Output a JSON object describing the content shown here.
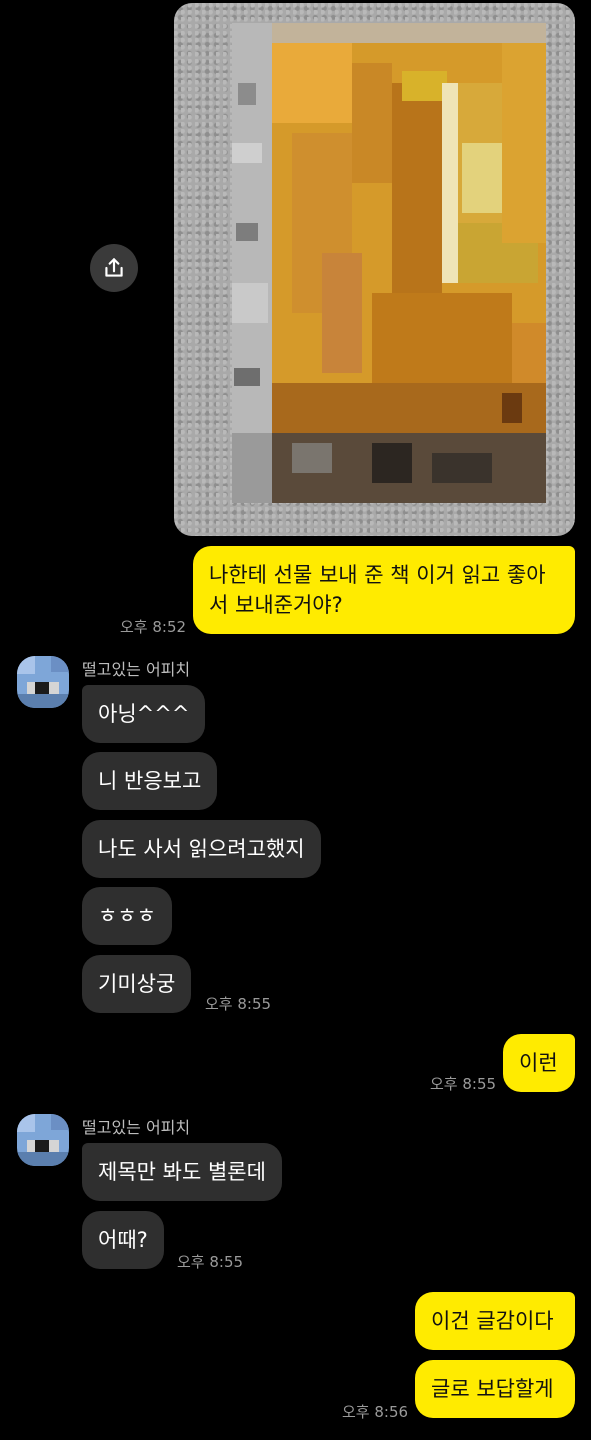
{
  "photo": {
    "description_icon": "image-thumbnail"
  },
  "share_icon": "share-upload-icon",
  "messages": [
    {
      "id": "m1",
      "side": "out",
      "text": "나한테 선물 보내 준 책 이거 읽고 좋아서 보내준거야?",
      "time": "오후 8:52"
    },
    {
      "id": "g1",
      "sender": "떨고있는 어피치"
    },
    {
      "id": "m2",
      "side": "in",
      "text": "아닝^^^"
    },
    {
      "id": "m3",
      "side": "in",
      "text": "니 반응보고"
    },
    {
      "id": "m4",
      "side": "in",
      "text": "나도 사서 읽으려고했지"
    },
    {
      "id": "m5",
      "side": "in",
      "text": "ㅎㅎㅎ"
    },
    {
      "id": "m6",
      "side": "in",
      "text": "기미상궁",
      "time": "오후 8:55"
    },
    {
      "id": "m7",
      "side": "out",
      "text": "이런",
      "time": "오후 8:55"
    },
    {
      "id": "g2",
      "sender": "떨고있는 어피치"
    },
    {
      "id": "m8",
      "side": "in",
      "text": "제목만 봐도 별론데"
    },
    {
      "id": "m9",
      "side": "in",
      "text": "어때?",
      "time": "오후 8:55"
    },
    {
      "id": "m10",
      "side": "out",
      "text": "이건 글감이다"
    },
    {
      "id": "m11",
      "side": "out",
      "text": "글로 보답할게",
      "time": "오후 8:56"
    }
  ],
  "colors": {
    "background": "#000000",
    "incoming_bubble": "#2f2f2f",
    "outgoing_bubble": "#ffeb00",
    "timestamp": "#9a9a9a"
  }
}
